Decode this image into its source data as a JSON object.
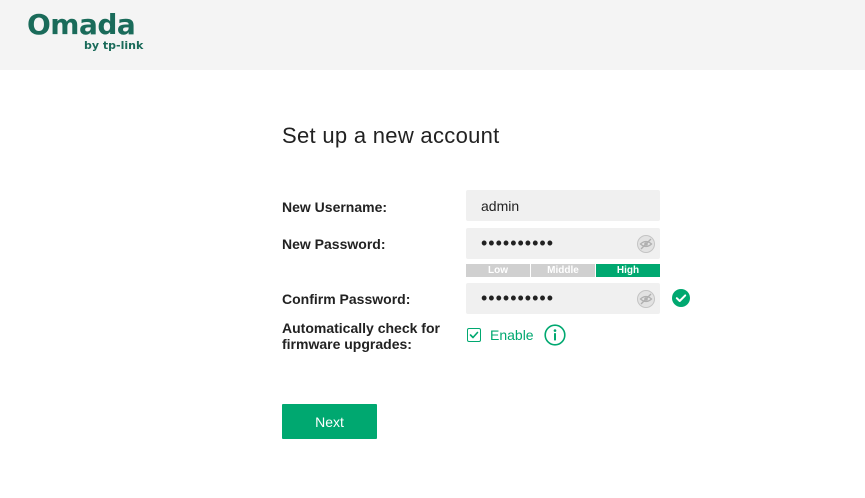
{
  "header": {
    "logo_main": "Omada",
    "logo_sub": "by tp-link",
    "background": "#f4f4f4",
    "logo_color": "#1a6b5a"
  },
  "form": {
    "title": "Set up a new account",
    "username_label": "New Username:",
    "username_value": "admin",
    "password_label": "New Password:",
    "password_value": "••••••••••",
    "password_visibility_icon": "eye-slash-icon",
    "strength": {
      "low": "Low",
      "middle": "Middle",
      "high": "High",
      "current": "high"
    },
    "confirm_label": "Confirm Password:",
    "confirm_value": "••••••••••",
    "confirm_status_icon": "check-circle-icon",
    "firmware_label_line1": "Automatically check for",
    "firmware_label_line2": "firmware upgrades:",
    "enable_label": "Enable",
    "enable_checked": true,
    "info_icon": "info-circle-icon",
    "next_button": "Next"
  },
  "colors": {
    "accent": "#00a870",
    "strength_inactive": "#d0d0d0",
    "field_background": "#f0f0f0"
  }
}
